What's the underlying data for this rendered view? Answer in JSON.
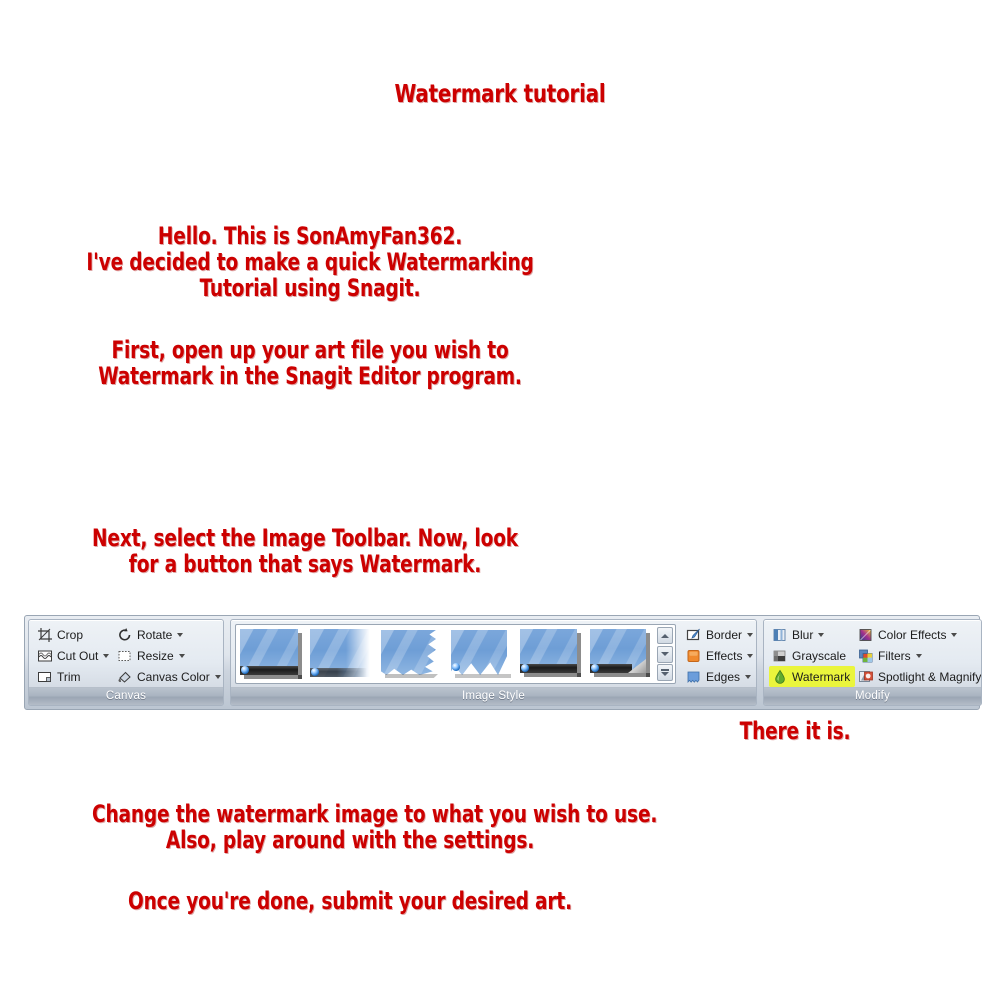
{
  "page": {
    "title": "Watermark tutorial",
    "text_color": "#cc0000",
    "background": "#ffffff"
  },
  "texts": {
    "title": "Watermark tutorial",
    "intro": "Hello. This is SonAmyFan362.\nI've decided to make a quick Watermarking\nTutorial using Snagit.",
    "first_step": "First, open up your art file you wish to\nWatermark in the Snagit Editor program.",
    "next_step": "Next, select the Image Toolbar. Now, look\nfor a button that says Watermark.",
    "pointer": "There it is.",
    "change_step": "Change the watermark image to what you wish to use.\nAlso, play around with the settings.",
    "final_step": "Once you're done, submit your desired art."
  },
  "ribbon": {
    "groups": [
      {
        "id": "canvas",
        "label": "Canvas",
        "columns": [
          {
            "items": [
              {
                "label": "Crop",
                "icon": "crop-icon",
                "has_caret": false
              },
              {
                "label": "Cut Out",
                "icon": "cut-out-icon",
                "has_caret": true
              },
              {
                "label": "Trim",
                "icon": "trim-icon",
                "has_caret": false
              }
            ]
          },
          {
            "items": [
              {
                "label": "Rotate",
                "icon": "rotate-icon",
                "has_caret": true
              },
              {
                "label": "Resize",
                "icon": "resize-icon",
                "has_caret": true
              },
              {
                "label": "Canvas Color",
                "icon": "canvas-color-icon",
                "has_caret": true
              }
            ]
          }
        ]
      },
      {
        "id": "image-style",
        "label": "Image Style",
        "gallery": {
          "thumbnails": [
            {
              "name": "style-plain-shadow"
            },
            {
              "name": "style-fade-edge"
            },
            {
              "name": "style-torn-right"
            },
            {
              "name": "style-torn-bottom"
            },
            {
              "name": "style-drop-shadow"
            },
            {
              "name": "style-page-curl"
            }
          ],
          "scroll_buttons": [
            {
              "name": "gallery-scroll-up",
              "glyph": "up"
            },
            {
              "name": "gallery-scroll-down",
              "glyph": "down"
            },
            {
              "name": "gallery-expand",
              "glyph": "down-bar"
            }
          ]
        },
        "columns": [
          {
            "items": [
              {
                "label": "Border",
                "icon": "border-icon",
                "has_caret": true
              },
              {
                "label": "Effects",
                "icon": "effects-icon",
                "has_caret": true
              },
              {
                "label": "Edges",
                "icon": "edges-icon",
                "has_caret": true
              }
            ]
          }
        ]
      },
      {
        "id": "modify",
        "label": "Modify",
        "columns": [
          {
            "items": [
              {
                "label": "Blur",
                "icon": "blur-icon",
                "has_caret": true
              },
              {
                "label": "Grayscale",
                "icon": "grayscale-icon",
                "has_caret": false
              },
              {
                "label": "Watermark",
                "icon": "watermark-icon",
                "has_caret": false,
                "highlighted": true
              }
            ]
          },
          {
            "items": [
              {
                "label": "Color Effects",
                "icon": "color-effects-icon",
                "has_caret": true
              },
              {
                "label": "Filters",
                "icon": "filters-icon",
                "has_caret": true
              },
              {
                "label": "Spotlight & Magnify",
                "icon": "spotlight-magnify-icon",
                "has_caret": false
              }
            ]
          }
        ]
      }
    ],
    "highlight_color": "#eaf53c"
  }
}
